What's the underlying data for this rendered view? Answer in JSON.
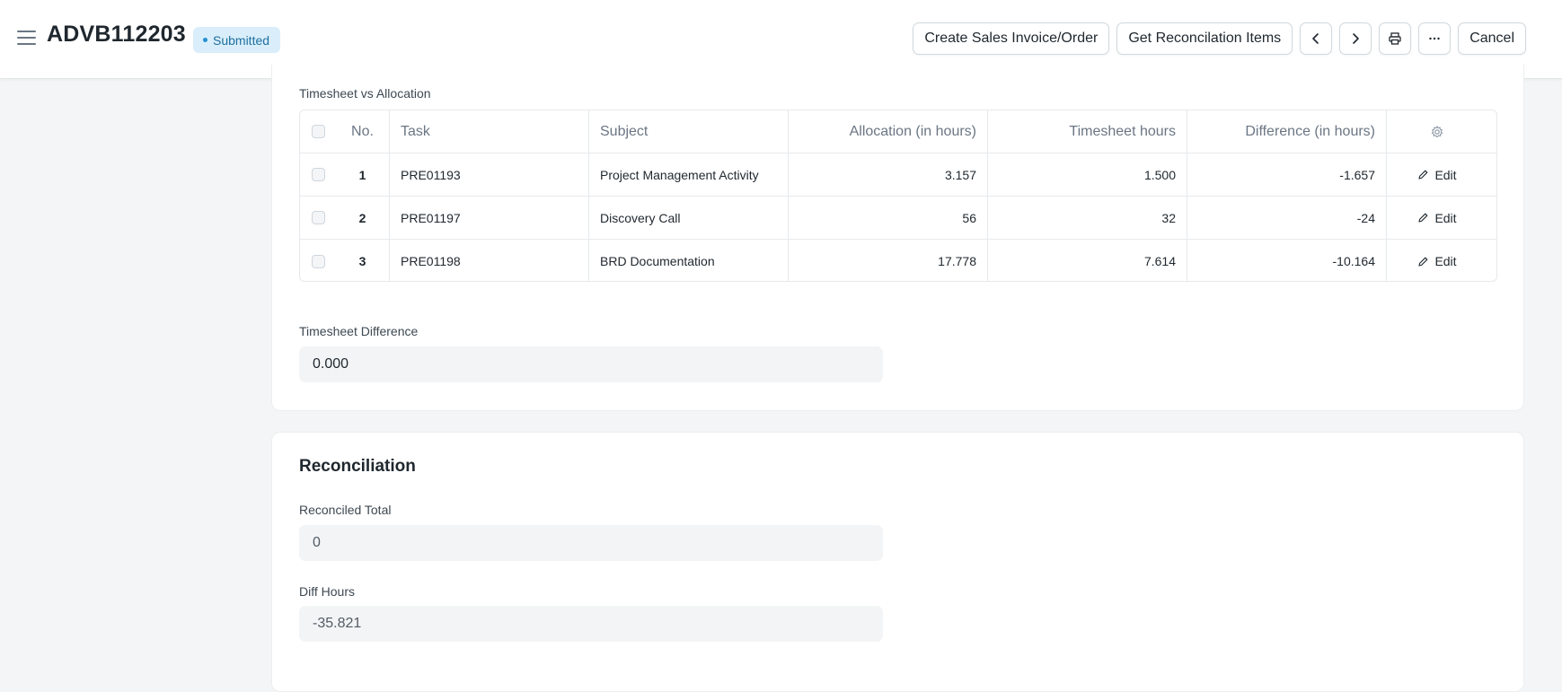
{
  "header": {
    "title": "ADVB112203",
    "status": "Submitted",
    "buttons": {
      "create_sales": "Create Sales Invoice/Order",
      "get_reconciliation": "Get Reconcilation Items",
      "cancel": "Cancel"
    }
  },
  "timesheet_section": {
    "table_label": "Timesheet vs Allocation",
    "columns": {
      "no": "No.",
      "task": "Task",
      "subject": "Subject",
      "allocation": "Allocation (in hours)",
      "timesheet": "Timesheet hours",
      "difference": "Difference (in hours)"
    },
    "rows": [
      {
        "no": "1",
        "task": "PRE01193",
        "subject": "Project Management Activity",
        "allocation": "3.157",
        "timesheet": "1.500",
        "difference": "-1.657",
        "action": "Edit"
      },
      {
        "no": "2",
        "task": "PRE01197",
        "subject": "Discovery Call",
        "allocation": "56",
        "timesheet": "32",
        "difference": "-24",
        "action": "Edit"
      },
      {
        "no": "3",
        "task": "PRE01198",
        "subject": "BRD Documentation",
        "allocation": "17.778",
        "timesheet": "7.614",
        "difference": "-10.164",
        "action": "Edit"
      }
    ],
    "difference_label": "Timesheet Difference",
    "difference_value": "0.000"
  },
  "reconciliation_section": {
    "title": "Reconciliation",
    "reconciled_total_label": "Reconciled Total",
    "reconciled_total_value": "0",
    "diff_hours_label": "Diff Hours",
    "diff_hours_value": "-35.821"
  },
  "icons": [
    "menu-icon",
    "chevron-left-icon",
    "chevron-right-icon",
    "printer-icon",
    "more-icon",
    "gear-icon",
    "pencil-icon"
  ],
  "colors": {
    "status_bg": "#d9eefa",
    "status_text": "#1f6fa0",
    "page_bg": "#f4f5f6"
  }
}
